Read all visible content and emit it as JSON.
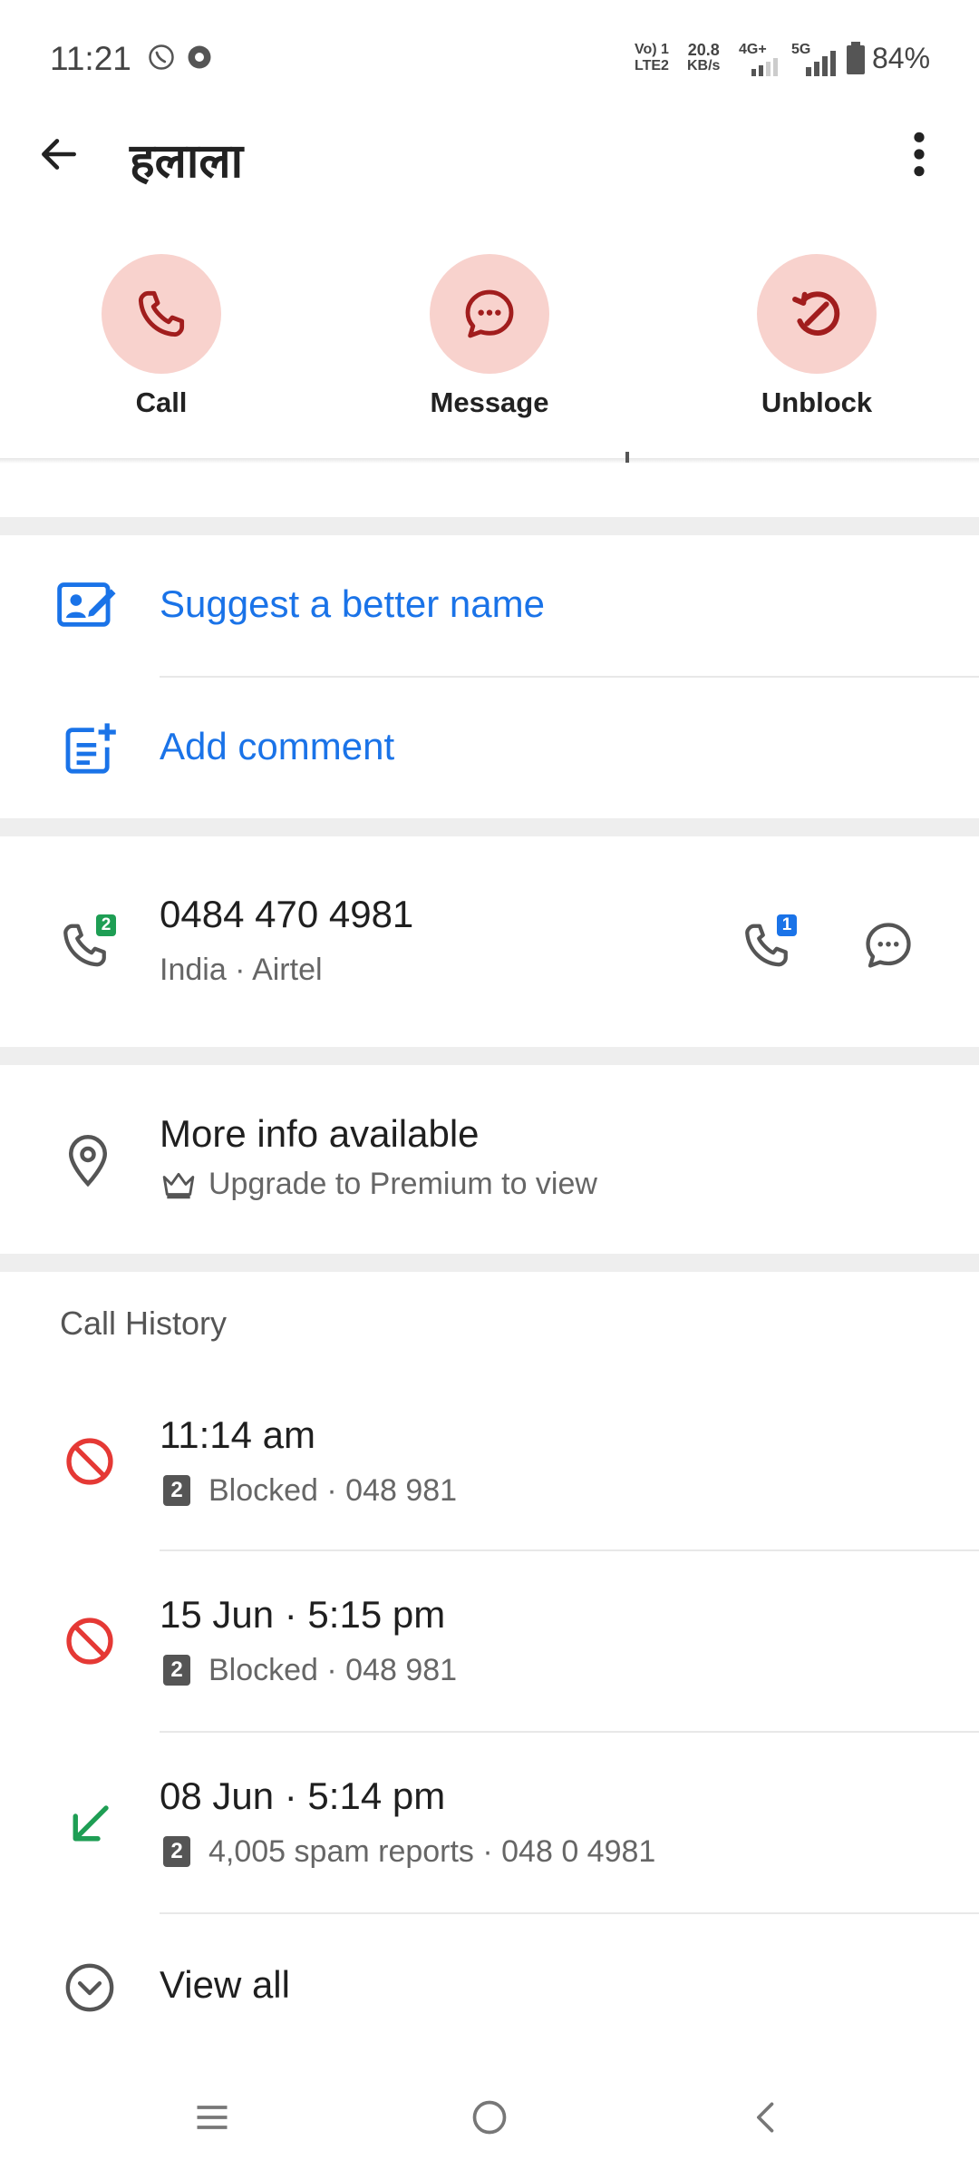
{
  "status_bar": {
    "time": "11:21",
    "network_1": "Vo) 1",
    "network_1b": "LTE2",
    "speed": "20.8",
    "speed_unit": "KB/s",
    "net_4g": "4G+",
    "net_5g": "5G",
    "battery": "84%"
  },
  "app_bar": {
    "title": "हलाला"
  },
  "actions": {
    "call_label": "Call",
    "message_label": "Message",
    "unblock_label": "Unblock"
  },
  "options": {
    "suggest_name": "Suggest a better name",
    "add_comment": "Add comment"
  },
  "number": {
    "phone": "0484 470 4981",
    "details": "India · Airtel",
    "sim_badge_left": "2",
    "sim_badge_right": "1"
  },
  "more_info": {
    "title": "More info available",
    "subtitle": "Upgrade to Premium to view"
  },
  "call_history": {
    "title": "Call History",
    "entries": [
      {
        "time": "11:14 am",
        "sim": "2",
        "detail": "Blocked · 048 981"
      },
      {
        "time": "15 Jun · 5:15 pm",
        "sim": "2",
        "detail": "Blocked · 048 981"
      },
      {
        "time": "08 Jun · 5:14 pm",
        "sim": "2",
        "detail": "4,005 spam reports · 048 0 4981"
      }
    ],
    "view_all": "View all"
  },
  "colors": {
    "accent_blue": "#1a73e8",
    "action_circle": "#f8d2cd",
    "action_icon": "#a11d1d",
    "blocked_red": "#e53935",
    "incoming_green": "#1e9e54"
  }
}
